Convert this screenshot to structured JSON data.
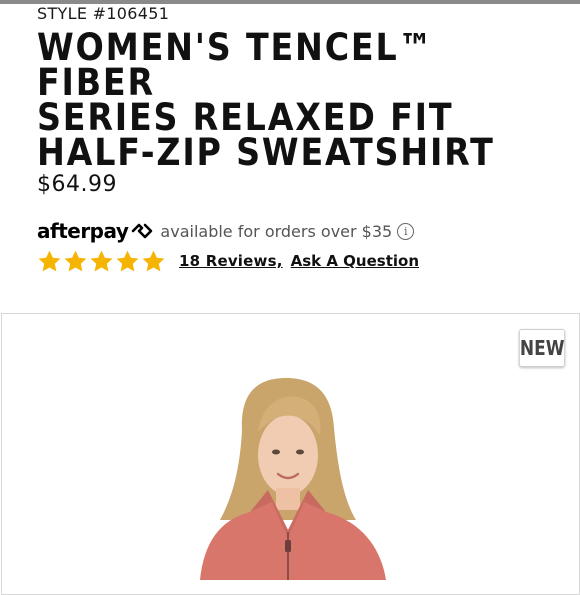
{
  "product": {
    "style_number": "STYLE #106451",
    "title": "WOMEN'S TENCEL™ FIBER\nSERIES RELAXED FIT\nHALF-ZIP SWEATSHIRT",
    "price": "$64.99"
  },
  "afterpay": {
    "logo": "afterpay",
    "text": "available for orders over $35",
    "info_icon": "info-icon"
  },
  "rating": {
    "stars": 5,
    "star_color": "#f5b400",
    "reviews_link": "18 Reviews,",
    "question_link": "Ask A Question"
  },
  "image": {
    "badge": "NEW",
    "description": "model-photo",
    "sweatshirt_color": "#d9766b"
  }
}
